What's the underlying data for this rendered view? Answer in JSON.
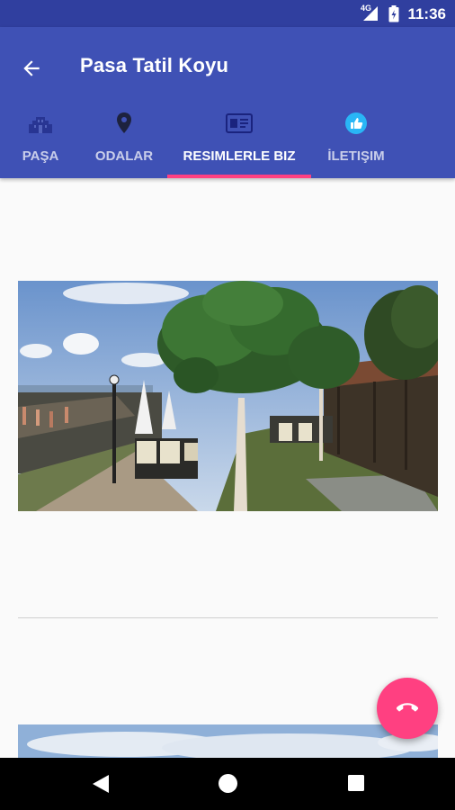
{
  "status_bar": {
    "network": "4G",
    "time": "11:36",
    "icons": [
      "signal-icon",
      "battery-icon"
    ]
  },
  "app_bar": {
    "title": "Pasa Tatil Koyu",
    "back_icon": "arrow-left-icon"
  },
  "tabs": [
    {
      "label": "PAŞA",
      "icon": "building-icon",
      "active": false
    },
    {
      "label": "ODALAR",
      "icon": "location-pin-icon",
      "active": false
    },
    {
      "label": "RESIMLERLE BIZ",
      "icon": "photo-id-icon",
      "active": true
    },
    {
      "label": "İLETIŞIM",
      "icon": "thumbs-up-icon",
      "active": false
    }
  ],
  "fab": {
    "icon": "phone-icon"
  },
  "nav_bar": {
    "icons": [
      "back-triangle-icon",
      "home-circle-icon",
      "recents-square-icon"
    ]
  },
  "colors": {
    "primary": "#3f51b5",
    "primary_dark": "#303f9f",
    "accent": "#ff4081"
  }
}
